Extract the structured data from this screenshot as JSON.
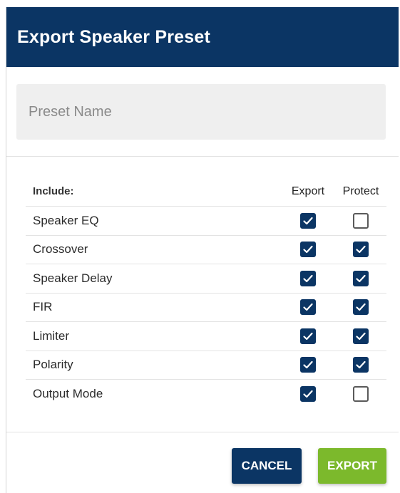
{
  "dialog": {
    "title": "Export Speaker Preset",
    "preset_name": {
      "value": "",
      "placeholder": "Preset Name"
    },
    "table": {
      "headers": {
        "include": "Include:",
        "export": "Export",
        "protect": "Protect"
      },
      "rows": [
        {
          "label": "Speaker EQ",
          "export": true,
          "protect": false
        },
        {
          "label": "Crossover",
          "export": true,
          "protect": true
        },
        {
          "label": "Speaker Delay",
          "export": true,
          "protect": true
        },
        {
          "label": "FIR",
          "export": true,
          "protect": true
        },
        {
          "label": "Limiter",
          "export": true,
          "protect": true
        },
        {
          "label": "Polarity",
          "export": true,
          "protect": true
        },
        {
          "label": "Output Mode",
          "export": true,
          "protect": false
        }
      ]
    },
    "buttons": {
      "cancel": "CANCEL",
      "export": "EXPORT"
    },
    "colors": {
      "primary": "#0b3564",
      "accent": "#7cb92c"
    }
  }
}
